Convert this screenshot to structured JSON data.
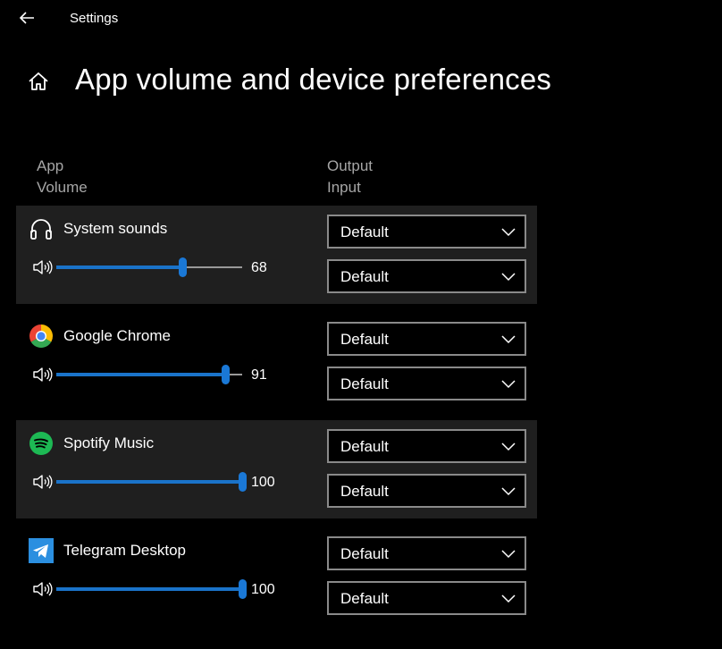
{
  "window": {
    "title": "Settings"
  },
  "page": {
    "title": "App volume and device preferences"
  },
  "columns": {
    "app": "App",
    "volume": "Volume",
    "output": "Output",
    "input": "Input"
  },
  "apps": [
    {
      "name": "System sounds",
      "icon": "headphones-icon",
      "volume": "68",
      "volume_fraction": 0.68,
      "output": "Default",
      "input": "Default"
    },
    {
      "name": "Google Chrome",
      "icon": "chrome-icon",
      "volume": "91",
      "volume_fraction": 0.91,
      "output": "Default",
      "input": "Default"
    },
    {
      "name": "Spotify Music",
      "icon": "spotify-icon",
      "volume": "100",
      "volume_fraction": 1.0,
      "output": "Default",
      "input": "Default"
    },
    {
      "name": "Telegram Desktop",
      "icon": "telegram-icon",
      "volume": "100",
      "volume_fraction": 1.0,
      "output": "Default",
      "input": "Default"
    }
  ],
  "colors": {
    "background": "#000000",
    "row_highlight": "#1f1f1f",
    "accent": "#1a78d6",
    "spotify": "#1db954",
    "telegram": "#2b8fe0"
  }
}
